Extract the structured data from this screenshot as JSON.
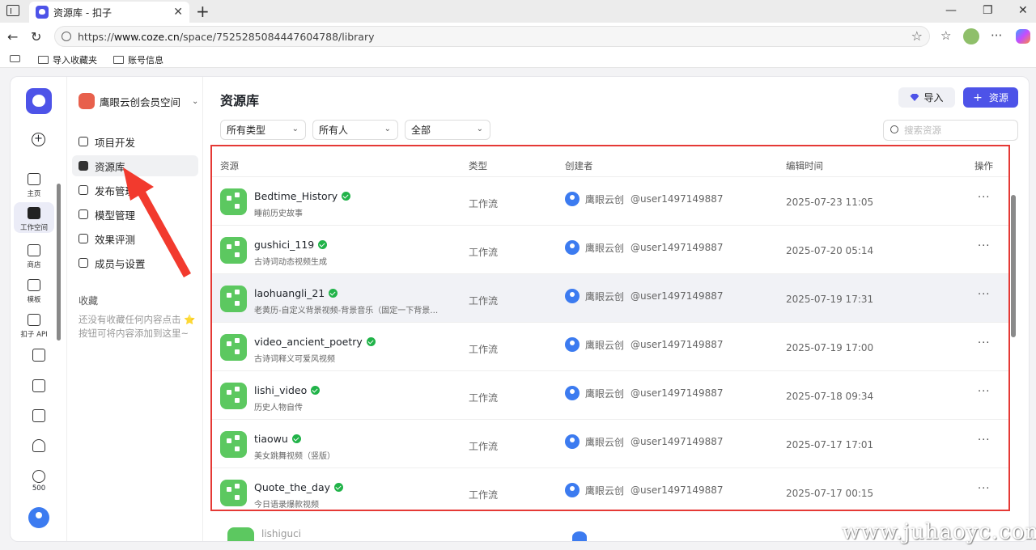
{
  "browser": {
    "tab_title": "资源库 - 扣子",
    "url_prefix": "https://",
    "url_host": "www.coze.cn",
    "url_path": "/space/7525285084447604788/library",
    "bookmarks": [
      "导入收藏夹",
      "账号信息"
    ]
  },
  "rail": {
    "items": [
      {
        "label": "主页"
      },
      {
        "label": "工作空间"
      },
      {
        "label": "商店"
      },
      {
        "label": "模板"
      },
      {
        "label": "扣子 API"
      }
    ],
    "score": "500"
  },
  "sidebar": {
    "workspace": "鹰眼云创会员空间",
    "menu": [
      "项目开发",
      "资源库",
      "发布管理",
      "模型管理",
      "效果评测",
      "成员与设置"
    ],
    "favorites_title": "收藏",
    "favorites_empty": "还没有收藏任何内容点击 ⭐ 按钮可将内容添加到这里~"
  },
  "main": {
    "title": "资源库",
    "import_label": "导入",
    "resource_label": "资源",
    "filters": [
      "所有类型",
      "所有人",
      "全部"
    ],
    "search_placeholder": "搜索资源",
    "columns": [
      "资源",
      "类型",
      "创建者",
      "编辑时间",
      "操作"
    ],
    "rows": [
      {
        "name": "Bedtime_History",
        "desc": "睡前历史故事",
        "type": "工作流",
        "creator": "鹰眼云创",
        "handle": "@user1497149887",
        "time": "2025-07-23 11:05"
      },
      {
        "name": "gushici_119",
        "desc": "古诗词动态视频生成",
        "type": "工作流",
        "creator": "鹰眼云创",
        "handle": "@user1497149887",
        "time": "2025-07-20 05:14"
      },
      {
        "name": "laohuangli_21",
        "desc": "老黄历-自定义背景视频-背景音乐（固定一下背景…",
        "type": "工作流",
        "creator": "鹰眼云创",
        "handle": "@user1497149887",
        "time": "2025-07-19 17:31"
      },
      {
        "name": "video_ancient_poetry",
        "desc": "古诗词释义可爱风视频",
        "type": "工作流",
        "creator": "鹰眼云创",
        "handle": "@user1497149887",
        "time": "2025-07-19 17:00"
      },
      {
        "name": "lishi_video",
        "desc": "历史人物自传",
        "type": "工作流",
        "creator": "鹰眼云创",
        "handle": "@user1497149887",
        "time": "2025-07-18 09:34"
      },
      {
        "name": "tiaowu",
        "desc": "美女跳舞视频（竖版）",
        "type": "工作流",
        "creator": "鹰眼云创",
        "handle": "@user1497149887",
        "time": "2025-07-17 17:01"
      },
      {
        "name": "Quote_the_day",
        "desc": "今日语录爆款视频",
        "type": "工作流",
        "creator": "鹰眼云创",
        "handle": "@user1497149887",
        "time": "2025-07-17 00:15"
      }
    ],
    "peek_row_name": "lishiguci"
  },
  "watermark": "www.juhaoyc.com",
  "colors": {
    "accent": "#4d53e8",
    "workflow_icon": "#5cc860",
    "highlight_box": "#e53935",
    "verified": "#21b349"
  }
}
